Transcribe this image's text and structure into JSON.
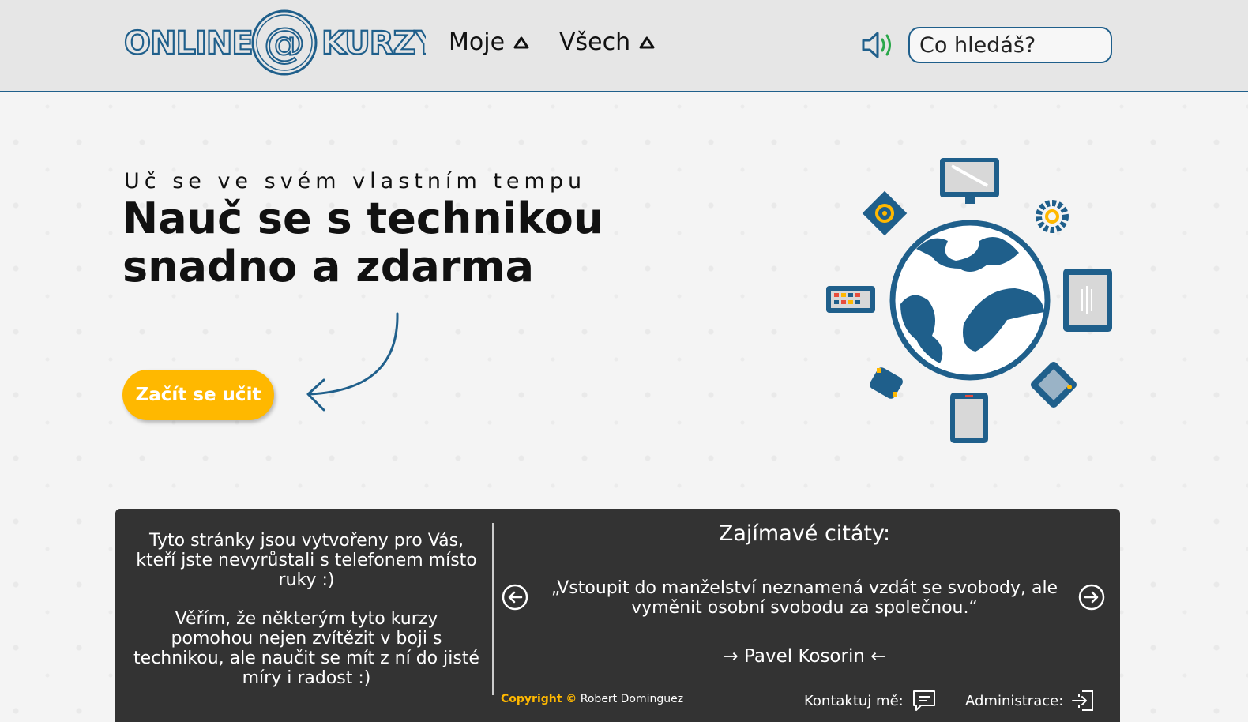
{
  "header": {
    "logo": {
      "left": "ONLINE",
      "symbol": "@",
      "right": "KURZY"
    },
    "nav": [
      {
        "label": "Moje"
      },
      {
        "label": "Všech"
      }
    ],
    "sound_icon": "speaker-icon",
    "search": {
      "placeholder": "Co hledáš?",
      "value": ""
    }
  },
  "hero": {
    "subtitle": "Uč se ve svém vlastním tempu",
    "title_line1": "Nauč se s technikou",
    "title_line2": "snadno a zdarma",
    "cta_label": "Začít se učit"
  },
  "panel": {
    "intro_p1": "Tyto stránky jsou vytvořeny pro Vás, kteří jste nevyrůstali s telefonem místo ruky :)",
    "intro_p2": "Věřím, že některým tyto kurzy pomohou nejen zvítězit v boji s technikou, ale naučit se mít z ní do jisté míry i radost :)",
    "quotes_heading": "Zajímavé citáty:",
    "quote": "„Vstoupit do manželství neznamená vzdát se svobody, ale vyměnit osobní svobodu za společnou.“",
    "author": "→ Pavel Kosorin ←",
    "copyright_label": "Copyright ©",
    "copyright_name": "Robert Dominguez",
    "contact_label": "Kontaktuj mě:",
    "admin_label": "Administrace:"
  },
  "colors": {
    "accent": "#ffb800",
    "brand_blue": "#1f5f8b",
    "panel_bg": "#333333",
    "header_bg": "#e6e6e6"
  }
}
